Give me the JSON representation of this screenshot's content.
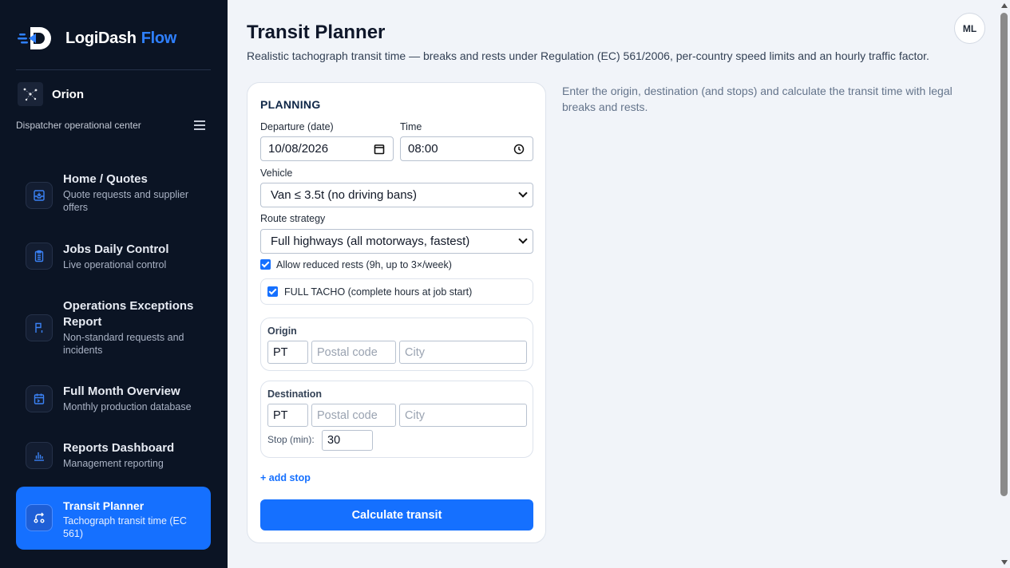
{
  "brand": {
    "name": "LogiDash",
    "accent": "Flow",
    "accent_color": "#2f80ff"
  },
  "workspace": {
    "name": "Orion",
    "subtitle": "Dispatcher operational center"
  },
  "sidebar": {
    "items": [
      {
        "title": "Home / Quotes",
        "desc": "Quote requests and supplier offers",
        "icon": "inbox-icon"
      },
      {
        "title": "Jobs Daily Control",
        "desc": "Live operational control",
        "icon": "clipboard-icon"
      },
      {
        "title": "Operations Exceptions Report",
        "desc": "Non-standard requests and incidents",
        "icon": "flag-icon"
      },
      {
        "title": "Full Month Overview",
        "desc": "Monthly production database",
        "icon": "calendar-icon"
      },
      {
        "title": "Reports Dashboard",
        "desc": "Management reporting",
        "icon": "bar-chart-icon"
      },
      {
        "title": "Transit Planner",
        "desc": "Tachograph transit time (EC 561)",
        "icon": "route-icon",
        "active": true
      }
    ]
  },
  "header": {
    "title": "Transit Planner",
    "subtitle": "Realistic tachograph transit time — breaks and rests under Regulation (EC) 561/2006, per-country speed limits and an hourly traffic factor.",
    "avatar_initials": "ML"
  },
  "hint": "Enter the origin, destination (and stops) and calculate the transit time with legal breaks and rests.",
  "planning": {
    "section_title": "PLANNING",
    "departure_label": "Departure (date)",
    "departure_value": "10/08/2026",
    "time_label": "Time",
    "time_value": "08:00",
    "vehicle_label": "Vehicle",
    "vehicle_value": "Van ≤ 3.5t (no driving bans)",
    "strategy_label": "Route strategy",
    "strategy_value": "Full highways (all motorways, fastest)",
    "reduced_rests_label": "Allow reduced rests (9h, up to 3×/week)",
    "reduced_rests_checked": true,
    "full_tacho_label": "FULL TACHO (complete hours at job start)",
    "full_tacho_checked": true,
    "origin": {
      "label": "Origin",
      "country": "PT",
      "postal_placeholder": "Postal code",
      "city_placeholder": "City"
    },
    "destination": {
      "label": "Destination",
      "country": "PT",
      "postal_placeholder": "Postal code",
      "city_placeholder": "City",
      "stop_label": "Stop (min):",
      "stop_value": "30"
    },
    "add_stop_label": "+ add stop",
    "calculate_label": "Calculate transit"
  },
  "colors": {
    "sidebar_bg": "#0b1424",
    "primary": "#1570ff",
    "page_bg": "#f1f4f9"
  }
}
